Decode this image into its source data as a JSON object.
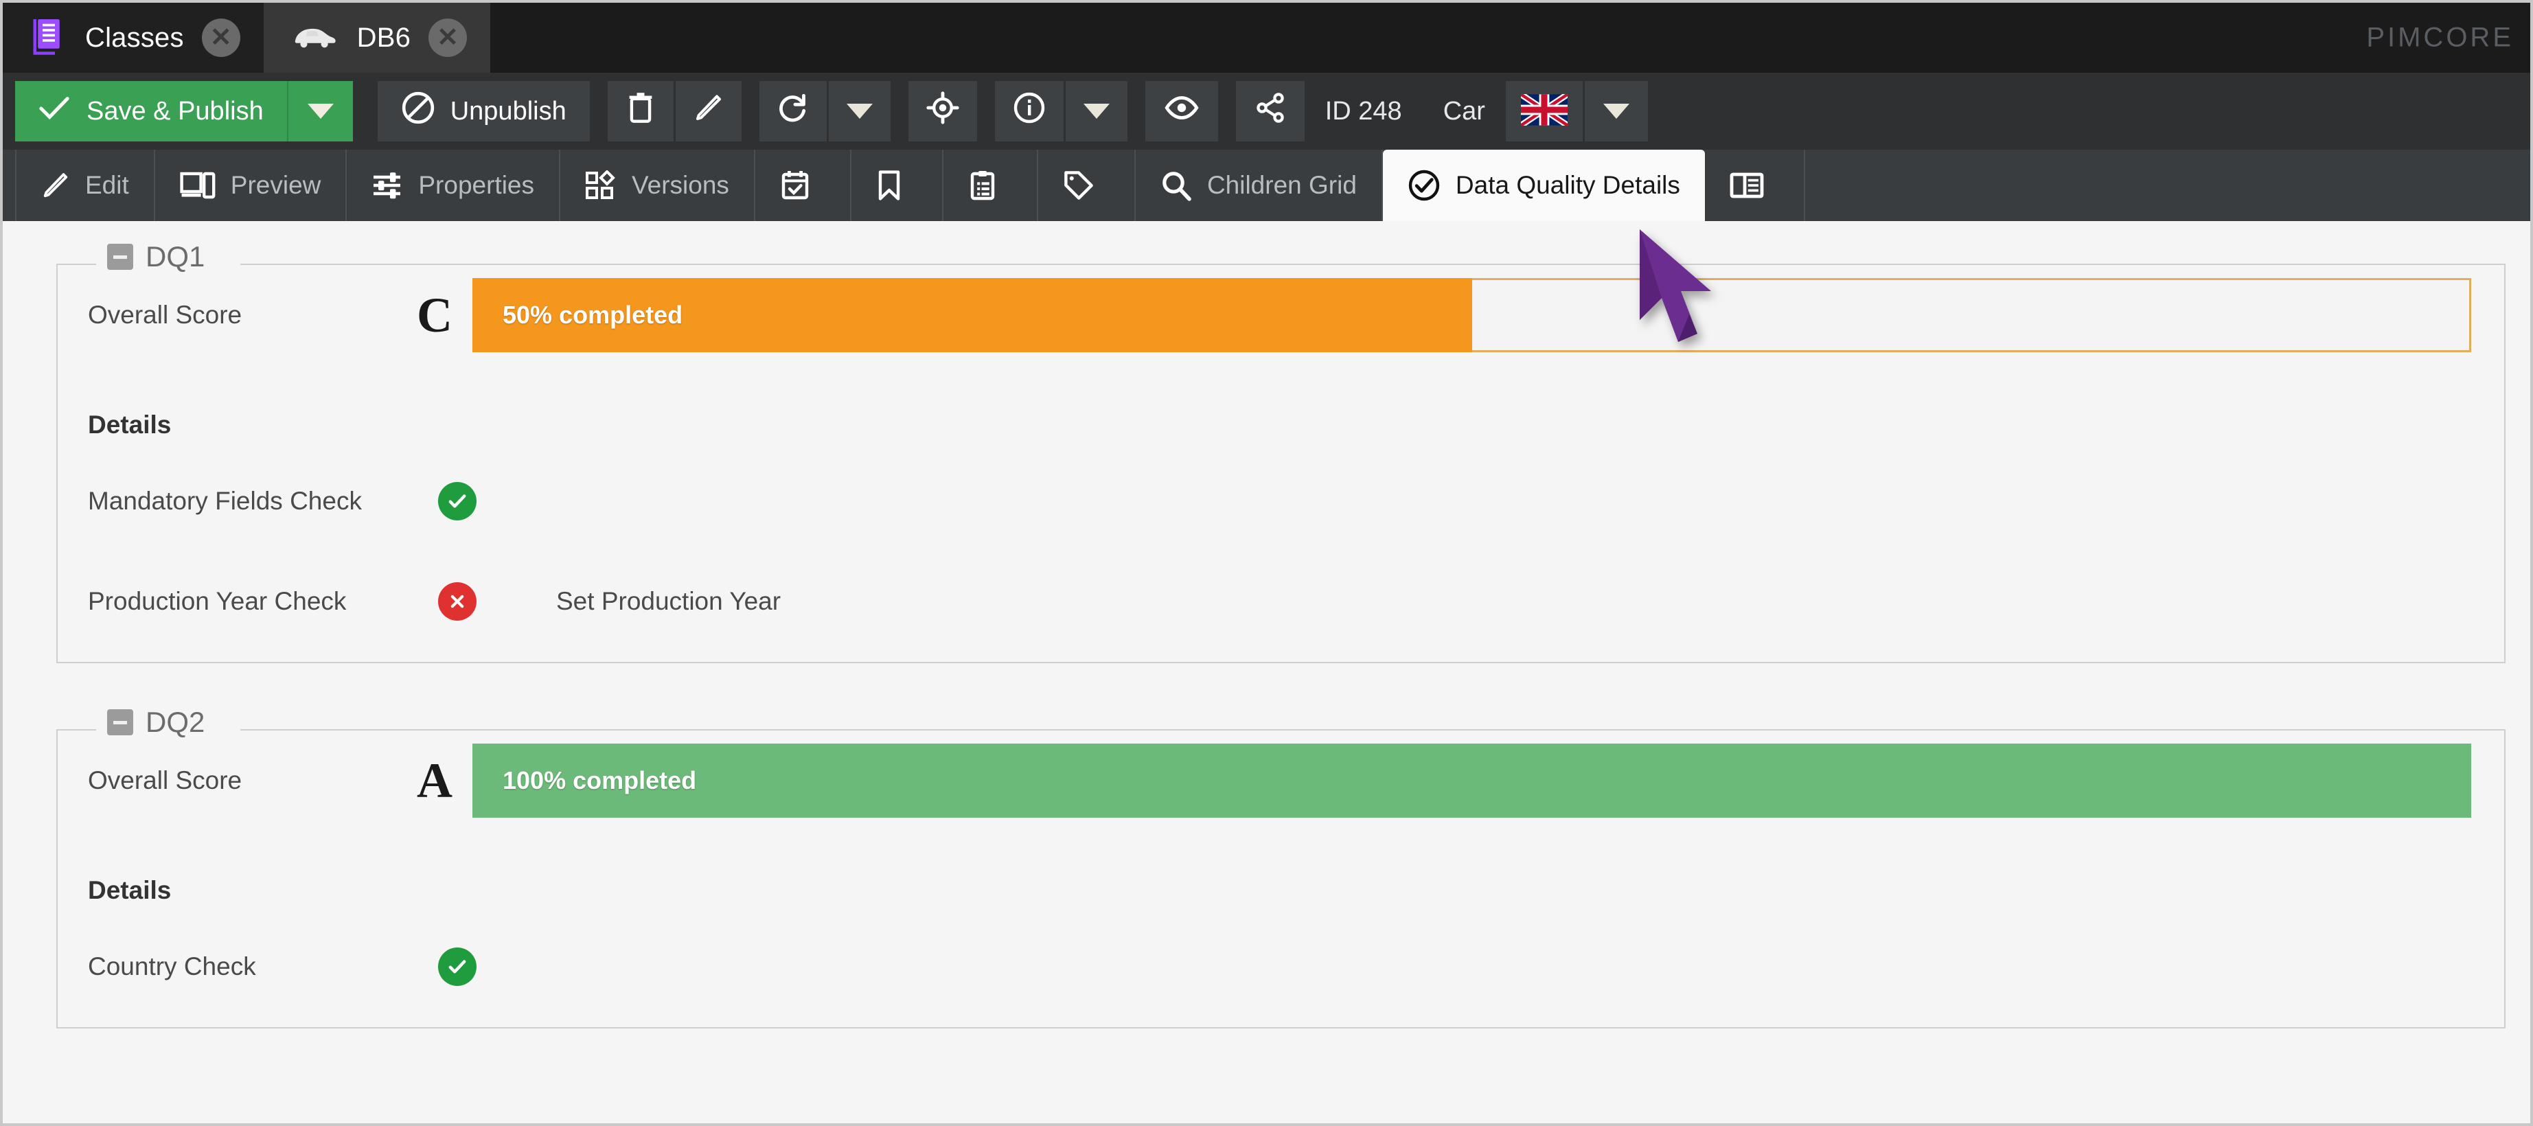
{
  "window": {
    "brand": "PIMCORE",
    "tabs": [
      {
        "label": "Classes",
        "icon": "classes-icon",
        "active": false,
        "close": "✕"
      },
      {
        "label": "DB6",
        "icon": "car-icon",
        "active": true,
        "close": "✕"
      }
    ]
  },
  "toolbar": {
    "save_label": "Save & Publish",
    "save_arrow_icon": "chevron-down-icon",
    "unpublish_label": "Unpublish",
    "buttons": [
      {
        "name": "delete-button",
        "icon": "trash-icon"
      },
      {
        "name": "rename-button",
        "icon": "pencil-icon"
      },
      {
        "name": "reload-button",
        "icon": "reload-icon"
      },
      {
        "name": "reload-options-button",
        "icon": "chevron-down-icon"
      },
      {
        "name": "locate-button",
        "icon": "target-icon"
      },
      {
        "name": "info-button",
        "icon": "info-icon"
      },
      {
        "name": "info-options-button",
        "icon": "chevron-down-icon"
      },
      {
        "name": "preview-button",
        "icon": "eye-icon"
      },
      {
        "name": "share-button",
        "icon": "share-icon"
      }
    ],
    "id_label": "ID 248",
    "class_label": "Car",
    "language_flag": "flag-gb-icon",
    "language_arrow_icon": "chevron-down-icon"
  },
  "subtabs": [
    {
      "label": "Edit",
      "icon": "pencil-icon",
      "active": false
    },
    {
      "label": "Preview",
      "icon": "devices-icon",
      "active": false
    },
    {
      "label": "Properties",
      "icon": "sliders-icon",
      "active": false
    },
    {
      "label": "Versions",
      "icon": "versions-icon",
      "active": false
    },
    {
      "label": "",
      "icon": "schedule-calendar-icon",
      "active": false
    },
    {
      "label": "",
      "icon": "bookmark-icon",
      "active": false
    },
    {
      "label": "",
      "icon": "clipboard-icon",
      "active": false
    },
    {
      "label": "",
      "icon": "tag-icon",
      "active": false
    },
    {
      "label": "Children Grid",
      "icon": "search-icon",
      "active": false
    },
    {
      "label": "Data Quality Details",
      "icon": "check-circle-icon",
      "active": true
    },
    {
      "label": "",
      "icon": "split-panel-icon",
      "active": false
    }
  ],
  "sections": [
    {
      "legend": "DQ1",
      "collapse_icon": "collapse-icon",
      "score_label": "Overall Score",
      "grade": "C",
      "progress_percent": 50,
      "progress_text": "50% completed",
      "progress_color": "#f5961d",
      "progress_border": "#e2ad5c",
      "details_title": "Details",
      "checks": [
        {
          "label": "Mandatory Fields Check",
          "status": "ok",
          "status_icon": "check-circle-icon",
          "note": ""
        },
        {
          "label": "Production Year Check",
          "status": "fail",
          "status_icon": "x-circle-icon",
          "note": "Set Production Year"
        }
      ]
    },
    {
      "legend": "DQ2",
      "collapse_icon": "collapse-icon",
      "score_label": "Overall Score",
      "grade": "A",
      "progress_percent": 100,
      "progress_text": "100% completed",
      "progress_color": "#6cba79",
      "progress_border": "#6cba79",
      "details_title": "Details",
      "checks": [
        {
          "label": "Country Check",
          "status": "ok",
          "status_icon": "check-circle-icon",
          "note": ""
        }
      ]
    }
  ],
  "cursor": {
    "icon": "mouse-pointer-icon",
    "color": "#6b2d8f"
  }
}
